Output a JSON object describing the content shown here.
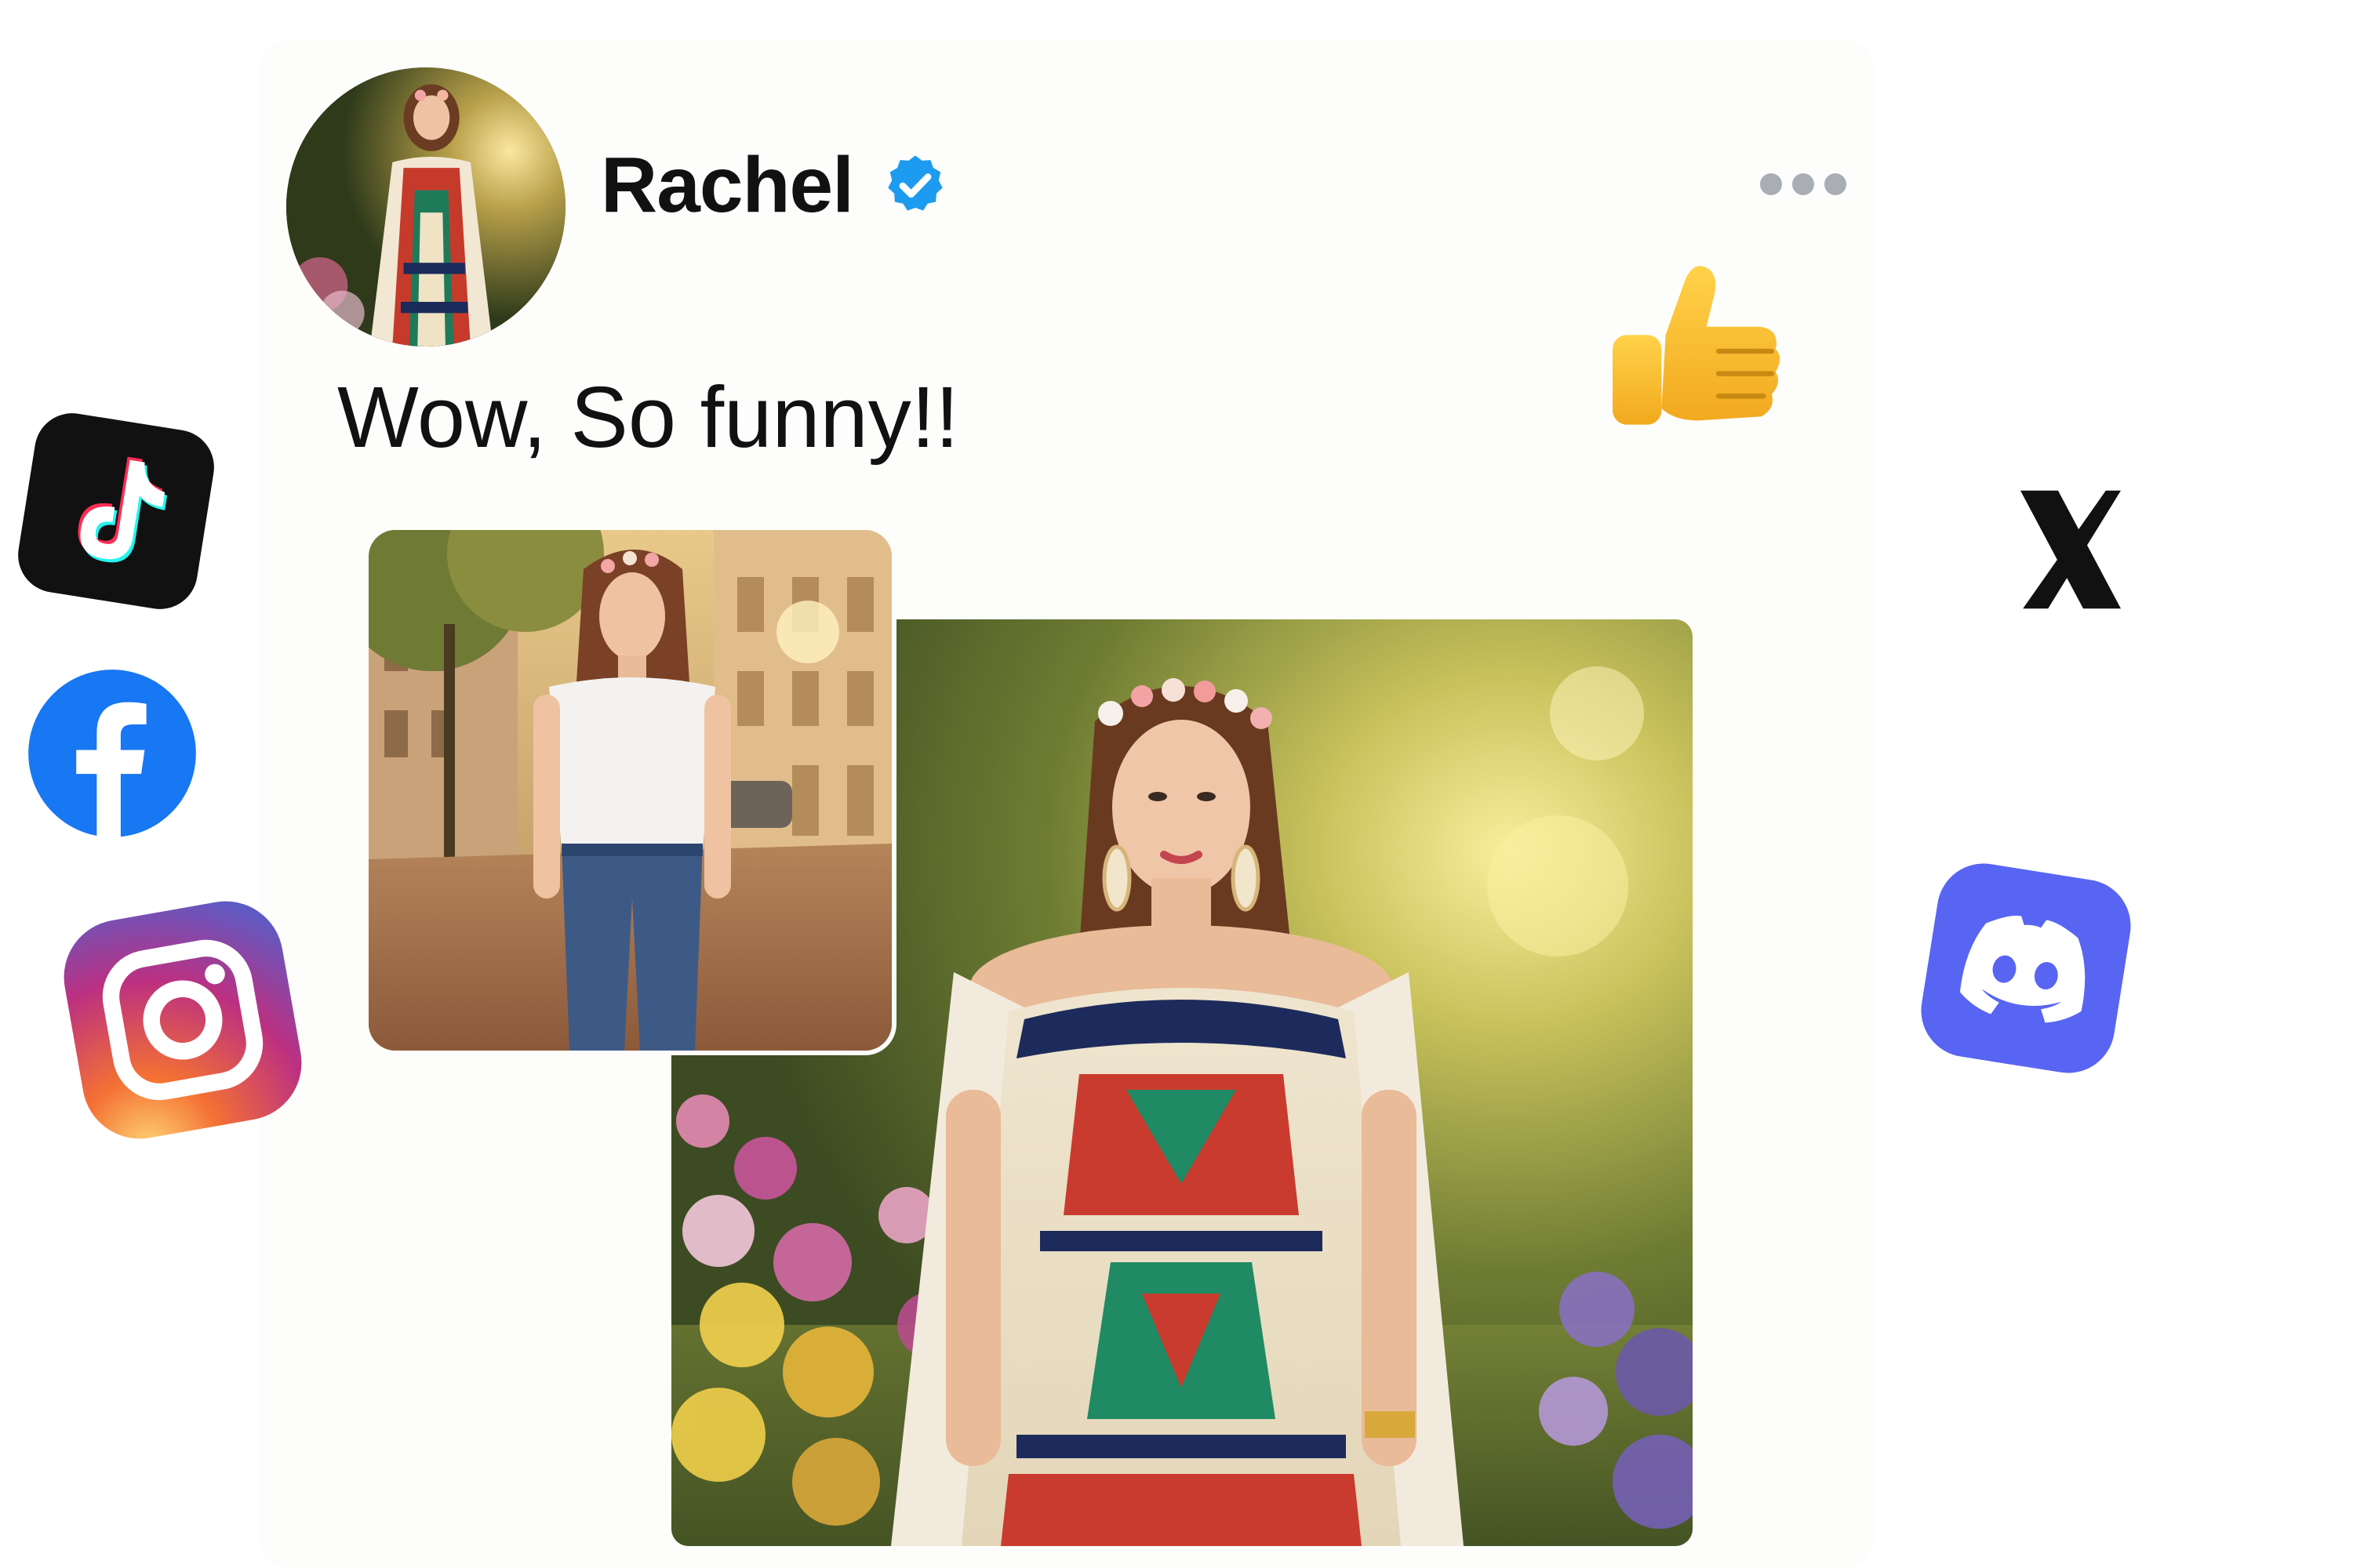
{
  "post": {
    "author": {
      "name": "Rachel",
      "verified": true,
      "avatar_icon": "avatar-photo"
    },
    "text": "Wow, So funny!!",
    "more_icon": "more-horizontal-icon",
    "images": [
      {
        "name": "woman-white-tshirt-street-photo"
      },
      {
        "name": "woman-embroidered-dress-garden-photo"
      }
    ]
  },
  "floating_icons": [
    {
      "name": "tiktok-icon",
      "color": "#111111"
    },
    {
      "name": "facebook-icon",
      "color": "#1877F2"
    },
    {
      "name": "instagram-icon",
      "color": "#DD2A7B"
    },
    {
      "name": "thumbs-up-icon",
      "color": "#F6B72D"
    },
    {
      "name": "x-icon",
      "color": "#111111"
    },
    {
      "name": "discord-icon",
      "color": "#5865F2"
    }
  ],
  "colors": {
    "verified_badge": "#1D9BF0",
    "text": "#111111",
    "more_dots": "#A9ADB4"
  }
}
